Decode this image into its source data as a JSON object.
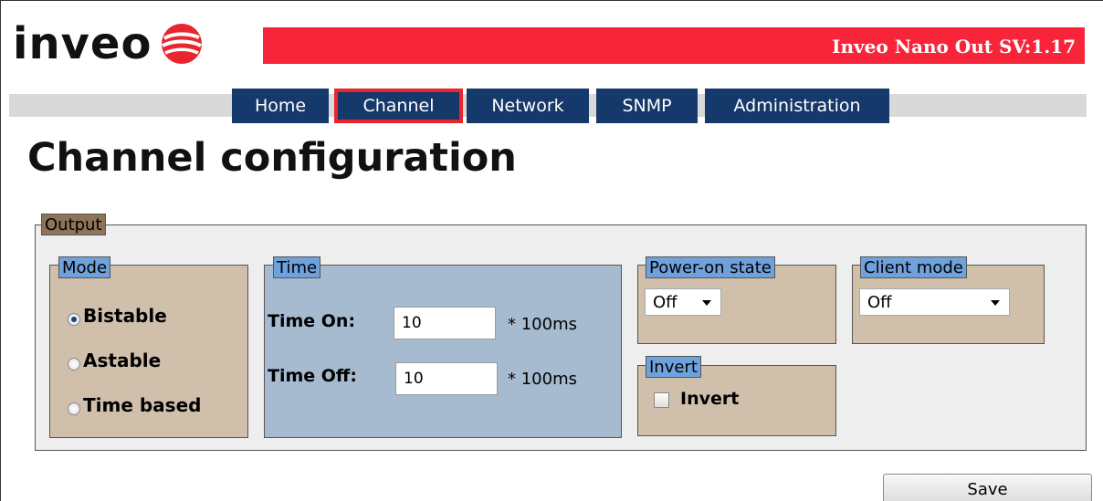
{
  "header": {
    "logo_text": "inveo",
    "version": "Inveo Nano Out SV:1.17",
    "colors": {
      "brand_red": "#f8243a",
      "nav_blue": "#15396b",
      "active_border": "#e8262e"
    }
  },
  "nav": {
    "items": [
      {
        "label": "Home",
        "active": false
      },
      {
        "label": "Channel",
        "active": true
      },
      {
        "label": "Network",
        "active": false
      },
      {
        "label": "SNMP",
        "active": false
      },
      {
        "label": "Administration",
        "active": false
      }
    ]
  },
  "page_title": "Channel configuration",
  "output": {
    "legend": "Output",
    "mode": {
      "legend": "Mode",
      "options": [
        {
          "label": "Bistable",
          "checked": true
        },
        {
          "label": "Astable",
          "checked": false
        },
        {
          "label": "Time based",
          "checked": false
        }
      ]
    },
    "time": {
      "legend": "Time",
      "time_on_label": "Time On:",
      "time_on_value": "10",
      "time_off_label": "Time Off:",
      "time_off_value": "10",
      "unit": "* 100ms"
    },
    "power_on": {
      "legend": "Power-on state",
      "selected": "Off"
    },
    "client_mode": {
      "legend": "Client mode",
      "selected": "Off"
    },
    "invert": {
      "legend": "Invert",
      "label": "Invert",
      "checked": false
    }
  },
  "actions": {
    "save_label": "Save"
  },
  "icons": {
    "logo": "inveo-logo-icon",
    "radio": "radio-icon",
    "dropdown": "chevron-down-icon",
    "checkbox": "checkbox-icon"
  }
}
